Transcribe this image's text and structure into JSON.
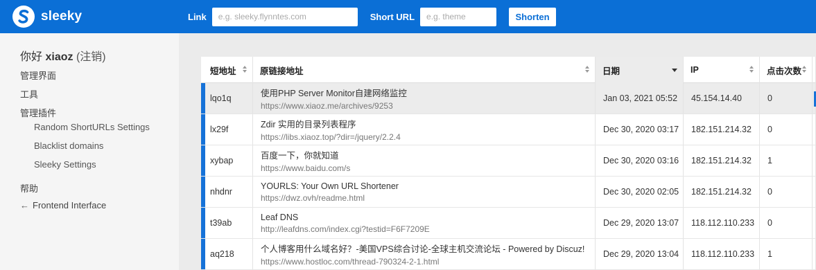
{
  "brand": {
    "name": "sleeky",
    "accent": "#0b6fd6"
  },
  "topbar": {
    "link_label": "Link",
    "link_placeholder": "e.g. sleeky.flynntes.com",
    "short_label": "Short URL",
    "short_placeholder": "e.g. theme",
    "shorten_button": "Shorten"
  },
  "sidebar": {
    "greeting": "你好",
    "username": "xiaoz",
    "logout": "(注销)",
    "items": [
      {
        "label": "管理界面"
      },
      {
        "label": "工具"
      },
      {
        "label": "管理插件"
      }
    ],
    "plugins": [
      {
        "label": "Random ShortURLs Settings"
      },
      {
        "label": "Blacklist domains"
      },
      {
        "label": "Sleeky Settings"
      }
    ],
    "help": "帮助",
    "frontend": "Frontend Interface",
    "frontend_icon": "arrow-left-icon"
  },
  "table": {
    "columns": [
      "短地址",
      "原链接地址",
      "日期",
      "IP",
      "点击次数"
    ],
    "sorted_column": "日期",
    "rows": [
      {
        "short": "lqo1q",
        "title": "使用PHP Server Monitor自建网络监控",
        "url": "https://www.xiaoz.me/archives/9253",
        "date": "Jan 03, 2021 05:52",
        "ip": "45.154.14.40",
        "clicks": "0"
      },
      {
        "short": "lx29f",
        "title": "Zdir 实用的目录列表程序",
        "url": "https://libs.xiaoz.top/?dir=/jquery/2.2.4",
        "date": "Dec 30, 2020 03:17",
        "ip": "182.151.214.32",
        "clicks": "0"
      },
      {
        "short": "xybap",
        "title": "百度一下，你就知道",
        "url": "https://www.baidu.com/s",
        "date": "Dec 30, 2020 03:16",
        "ip": "182.151.214.32",
        "clicks": "1"
      },
      {
        "short": "nhdnr",
        "title": "YOURLS: Your Own URL Shortener",
        "url": "https://dwz.ovh/readme.html",
        "date": "Dec 30, 2020 02:05",
        "ip": "182.151.214.32",
        "clicks": "0"
      },
      {
        "short": "t39ab",
        "title": "Leaf DNS",
        "url": "http://leafdns.com/index.cgi?testid=F6F7209E",
        "date": "Dec 29, 2020 13:07",
        "ip": "118.112.110.233",
        "clicks": "0"
      },
      {
        "short": "aq218",
        "title": "个人博客用什么域名好？-美国VPS综合讨论-全球主机交流论坛 - Powered by Discuz!",
        "url": "https://www.hostloc.com/thread-790324-2-1.html",
        "date": "Dec 29, 2020 13:04",
        "ip": "118.112.110.233",
        "clicks": "1"
      }
    ]
  }
}
